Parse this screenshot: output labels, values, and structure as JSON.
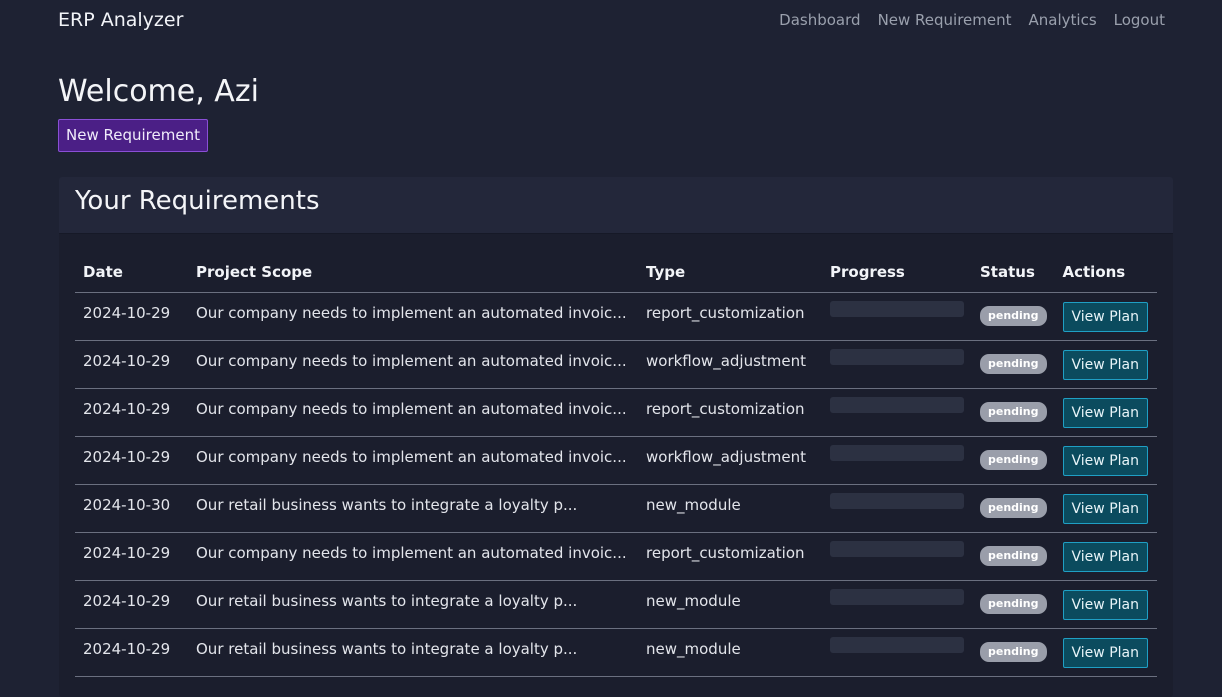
{
  "nav": {
    "brand": "ERP Analyzer",
    "links": [
      "Dashboard",
      "New Requirement",
      "Analytics",
      "Logout"
    ]
  },
  "page": {
    "welcome": "Welcome, Azi",
    "new_requirement_button": "New Requirement"
  },
  "requirements": {
    "title": "Your Requirements",
    "columns": [
      "Date",
      "Project Scope",
      "Type",
      "Progress",
      "Status",
      "Actions"
    ],
    "rows": [
      {
        "date": "2024-10-29",
        "scope": "Our company needs to implement an automated invoic...",
        "type": "report_customization",
        "progress": 0,
        "status": "pending",
        "action": "View Plan"
      },
      {
        "date": "2024-10-29",
        "scope": "Our company needs to implement an automated invoic...",
        "type": "workflow_adjustment",
        "progress": 0,
        "status": "pending",
        "action": "View Plan"
      },
      {
        "date": "2024-10-29",
        "scope": "Our company needs to implement an automated invoic...",
        "type": "report_customization",
        "progress": 0,
        "status": "pending",
        "action": "View Plan"
      },
      {
        "date": "2024-10-29",
        "scope": "Our company needs to implement an automated invoic...",
        "type": "workflow_adjustment",
        "progress": 0,
        "status": "pending",
        "action": "View Plan"
      },
      {
        "date": "2024-10-30",
        "scope": "Our retail business wants to integrate a loyalty p...",
        "type": "new_module",
        "progress": 0,
        "status": "pending",
        "action": "View Plan"
      },
      {
        "date": "2024-10-29",
        "scope": "Our company needs to implement an automated invoic...",
        "type": "report_customization",
        "progress": 0,
        "status": "pending",
        "action": "View Plan"
      },
      {
        "date": "2024-10-29",
        "scope": "Our retail business wants to integrate a loyalty p...",
        "type": "new_module",
        "progress": 0,
        "status": "pending",
        "action": "View Plan"
      },
      {
        "date": "2024-10-29",
        "scope": "Our retail business wants to integrate a loyalty p...",
        "type": "new_module",
        "progress": 0,
        "status": "pending",
        "action": "View Plan"
      }
    ]
  },
  "colors": {
    "background": "#1e2233",
    "accent_purple": "#4b1f86",
    "button_teal": "#0b4b5e",
    "badge_gray": "#9a9eaa"
  }
}
